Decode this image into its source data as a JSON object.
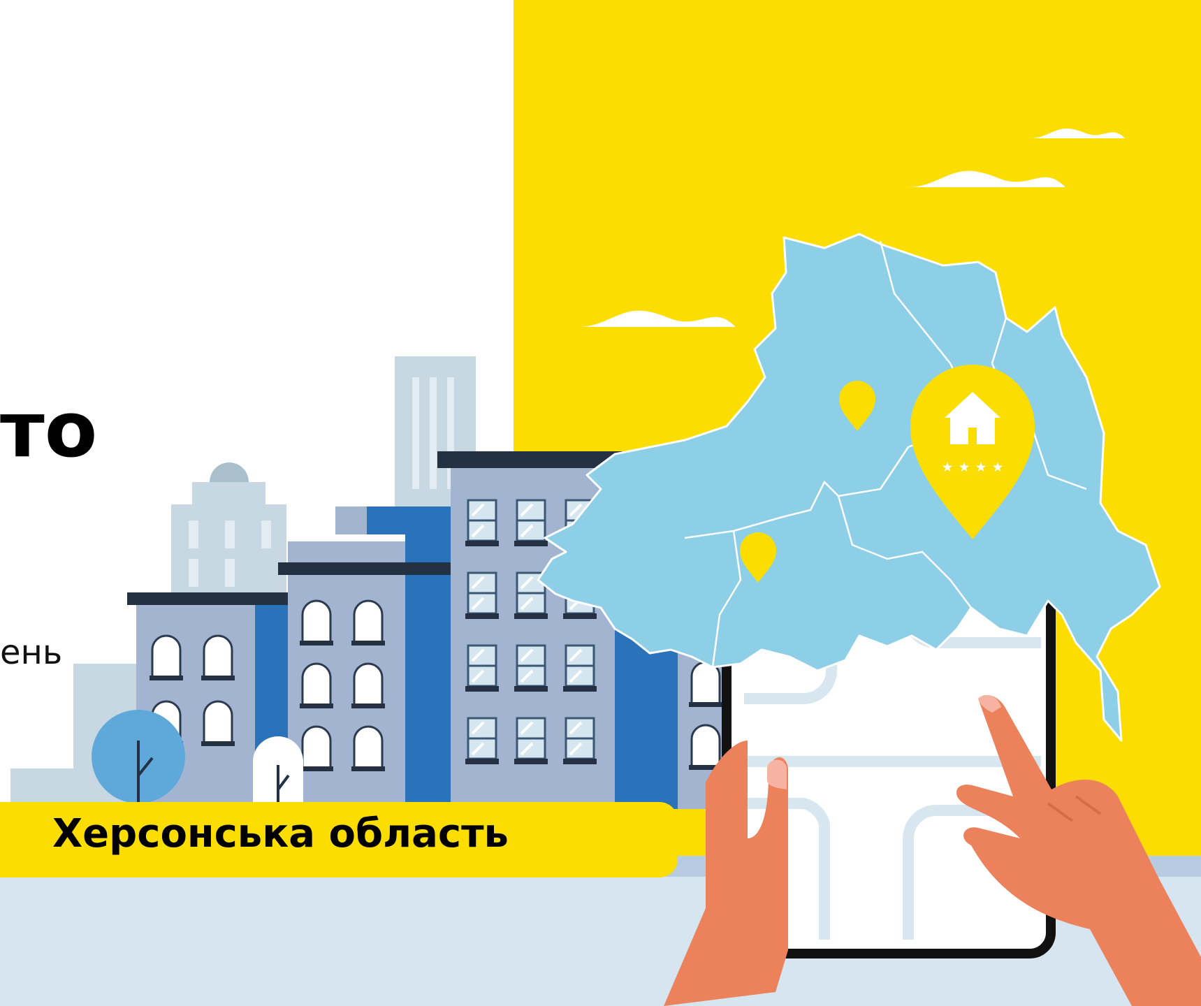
{
  "headline_fragment": "то",
  "subtext_fragment": "ень",
  "region_label": "Херсонська область",
  "icons": [
    "cloud-icon",
    "map-pin-icon",
    "house-icon",
    "star-icon"
  ],
  "colors": {
    "yellow": "#FBDE00",
    "map_blue": "#8ECFE8",
    "building_slate": "#A3B4D1",
    "building_blue": "#2A72B9",
    "skin": "#EC825C",
    "floor": "#D6E5EF"
  },
  "rating_stars": 4
}
